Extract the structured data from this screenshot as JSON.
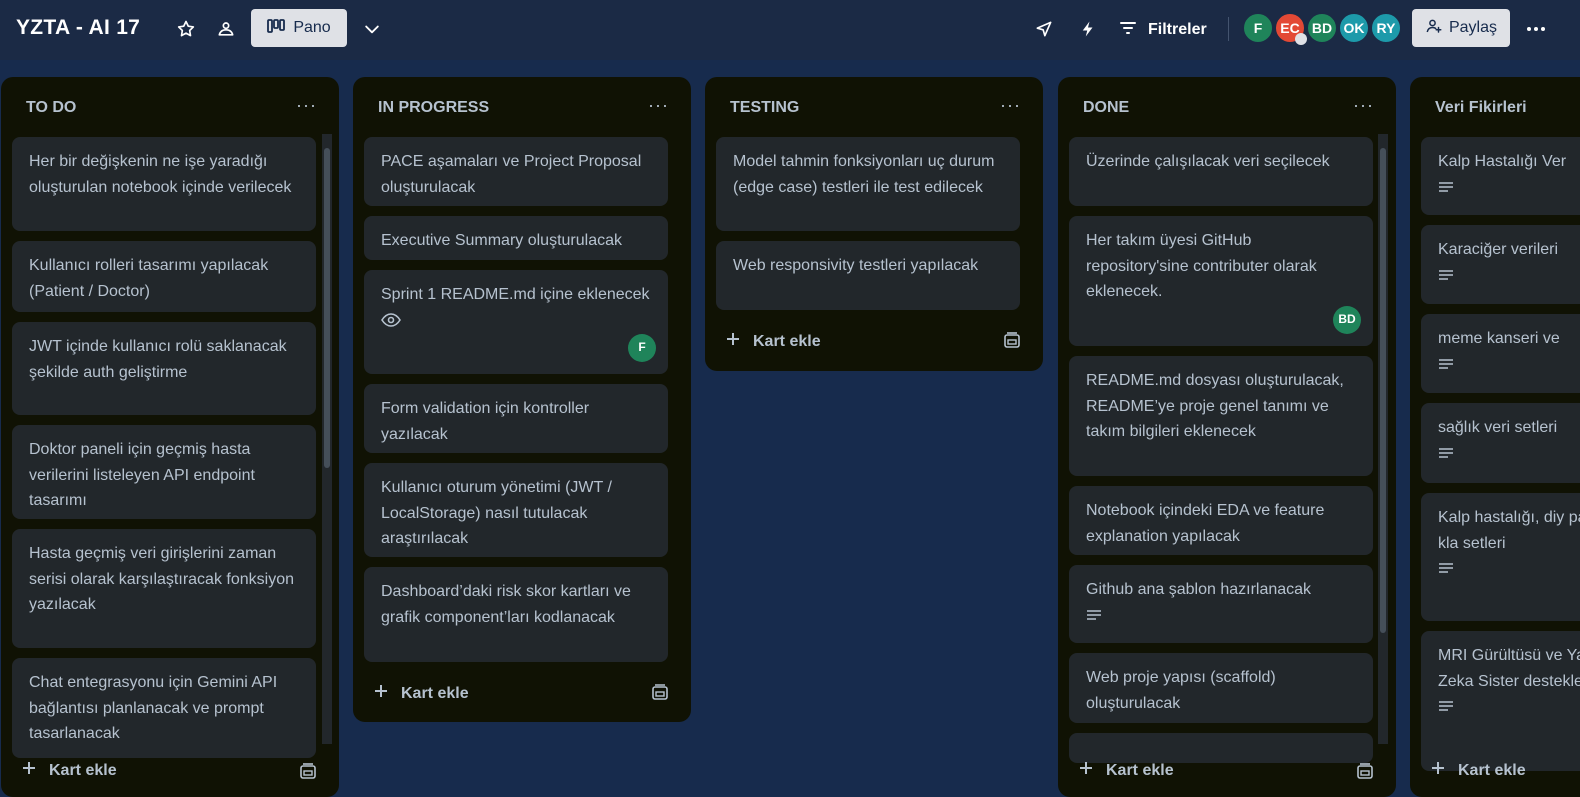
{
  "header": {
    "board_title": "YZTA - AI 17",
    "star_icon": "star-icon",
    "visibility_icon": "team-visibility-icon",
    "view_label": "Pano",
    "view_icon": "board-view-icon",
    "dropdown_icon": "chevron-down-icon",
    "power_up_icon": "rocket-icon",
    "automation_icon": "lightning-icon",
    "filter_label": "Filtreler",
    "filter_icon": "filter-icon",
    "members": [
      {
        "initials": "F",
        "color": "#1f845a"
      },
      {
        "initials": "EC",
        "color": "#e34935"
      },
      {
        "initials": "BD",
        "color": "#1f845a"
      },
      {
        "initials": "OK",
        "color": "#1d9aaa"
      },
      {
        "initials": "RY",
        "color": "#1d9aaa"
      }
    ],
    "share_label": "Paylaş",
    "more_icon": "more-horizontal-icon"
  },
  "lists": [
    {
      "title": "TO DO",
      "add_card_label": "Kart ekle",
      "cards": [
        {
          "text": "Her bir değişkenin ne işe yaradığı oluşturulan notebook içinde verilecek"
        },
        {
          "text": "Kullanıcı rolleri tasarımı yapılacak (Patient / Doctor)"
        },
        {
          "text": "JWT içinde kullanıcı rolü saklanacak şekilde auth geliştirme"
        },
        {
          "text": "Doktor paneli için geçmiş hasta verilerini listeleyen API endpoint tasarımı"
        },
        {
          "text": "Hasta geçmiş veri girişlerini zaman serisi olarak karşılaştıracak fonksiyon yazılacak"
        },
        {
          "text": "Chat entegrasyonu için Gemini API bağlantısı planlanacak ve prompt tasarlanacak"
        }
      ]
    },
    {
      "title": "IN PROGRESS",
      "add_card_label": "Kart ekle",
      "cards": [
        {
          "text": "PACE aşamaları ve Project Proposal oluşturulacak"
        },
        {
          "text": "Executive Summary oluşturulacak"
        },
        {
          "text": "Sprint 1 README.md içine eklenecek",
          "badge_icon": "eye-icon",
          "member": "F"
        },
        {
          "text": "Form validation için kontroller yazılacak"
        },
        {
          "text": "Kullanıcı oturum yönetimi (JWT / LocalStorage) nasıl tutulacak araştırılacak"
        },
        {
          "text": "Dashboard’daki risk skor kartları ve grafik component’ları kodlanacak"
        }
      ]
    },
    {
      "title": "TESTING",
      "add_card_label": "Kart ekle",
      "cards": [
        {
          "text": "Model tahmin fonksiyonları uç durum (edge case) testleri ile test edilecek"
        },
        {
          "text": "Web responsivity testleri yapılacak"
        }
      ]
    },
    {
      "title": "DONE",
      "add_card_label": "Kart ekle",
      "cards": [
        {
          "text": "Üzerinde çalışılacak veri seçilecek"
        },
        {
          "text": "Her takım üyesi GitHub repository'sine contributer olarak eklenecek.",
          "member": "BD"
        },
        {
          "text": "README.md dosyası oluşturulacak, README’ye proje genel tanımı ve takım bilgileri eklenecek"
        },
        {
          "text": "Notebook içindeki EDA ve feature explanation yapılacak"
        },
        {
          "text": "Github ana şablon hazırlanacak",
          "badge_icon": "description-icon"
        },
        {
          "text": "Web proje yapısı (scaffold) oluşturulacak"
        }
      ]
    },
    {
      "title": "Veri Fikirleri",
      "add_card_label": "Kart ekle",
      "cards": [
        {
          "text": "Kalp Hastalığı Ver",
          "badge_icon": "description-icon"
        },
        {
          "text": "Karaciğer verileri",
          "badge_icon": "description-icon"
        },
        {
          "text": "meme kanseri ve",
          "badge_icon": "description-icon"
        },
        {
          "text": "sağlık veri setleri",
          "badge_icon": "description-icon"
        },
        {
          "text": "Kalp hastalığı, diy parkinson gibi kla setleri",
          "badge_icon": "description-icon"
        },
        {
          "text": "MRI Gürültüsü ve Yapay Zeka Sister destekleyici)",
          "badge_icon": "description-icon"
        }
      ]
    }
  ]
}
